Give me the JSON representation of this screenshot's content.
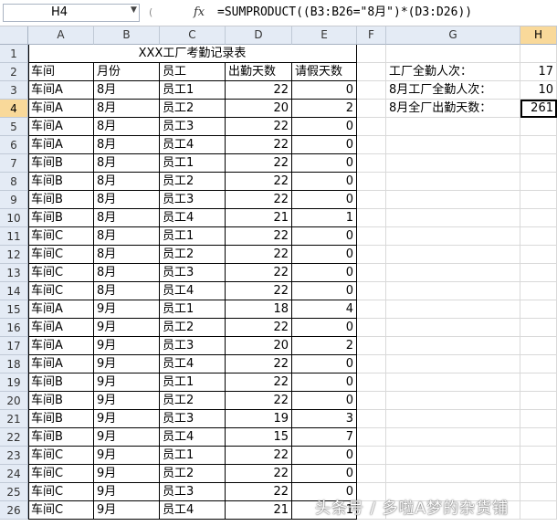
{
  "formula_bar": {
    "name_box": "H4",
    "fx_label": "fx",
    "formula": "=SUMPRODUCT((B3:B26=\"8月\")*(D3:D26))"
  },
  "columns": [
    "A",
    "B",
    "C",
    "D",
    "E",
    "F",
    "G",
    "H"
  ],
  "rows": [
    "1",
    "2",
    "3",
    "4",
    "5",
    "6",
    "7",
    "8",
    "9",
    "10",
    "11",
    "12",
    "13",
    "14",
    "15",
    "16",
    "17",
    "18",
    "19",
    "20",
    "21",
    "22",
    "23",
    "24",
    "25",
    "26"
  ],
  "sheet": {
    "title": "XXX工厂考勤记录表",
    "headers": [
      "车间",
      "月份",
      "员工",
      "出勤天数",
      "请假天数"
    ],
    "data": [
      [
        "车间A",
        "8月",
        "员工1",
        "22",
        "0"
      ],
      [
        "车间A",
        "8月",
        "员工2",
        "20",
        "2"
      ],
      [
        "车间A",
        "8月",
        "员工3",
        "22",
        "0"
      ],
      [
        "车间A",
        "8月",
        "员工4",
        "22",
        "0"
      ],
      [
        "车间B",
        "8月",
        "员工1",
        "22",
        "0"
      ],
      [
        "车间B",
        "8月",
        "员工2",
        "22",
        "0"
      ],
      [
        "车间B",
        "8月",
        "员工3",
        "22",
        "0"
      ],
      [
        "车间B",
        "8月",
        "员工4",
        "21",
        "1"
      ],
      [
        "车间C",
        "8月",
        "员工1",
        "22",
        "0"
      ],
      [
        "车间C",
        "8月",
        "员工2",
        "22",
        "0"
      ],
      [
        "车间C",
        "8月",
        "员工3",
        "22",
        "0"
      ],
      [
        "车间C",
        "8月",
        "员工4",
        "22",
        "0"
      ],
      [
        "车间A",
        "9月",
        "员工1",
        "18",
        "4"
      ],
      [
        "车间A",
        "9月",
        "员工2",
        "22",
        "0"
      ],
      [
        "车间A",
        "9月",
        "员工3",
        "20",
        "2"
      ],
      [
        "车间A",
        "9月",
        "员工4",
        "22",
        "0"
      ],
      [
        "车间B",
        "9月",
        "员工1",
        "22",
        "0"
      ],
      [
        "车间B",
        "9月",
        "员工2",
        "22",
        "0"
      ],
      [
        "车间B",
        "9月",
        "员工3",
        "19",
        "3"
      ],
      [
        "车间B",
        "9月",
        "员工4",
        "15",
        "7"
      ],
      [
        "车间C",
        "9月",
        "员工1",
        "22",
        "0"
      ],
      [
        "车间C",
        "9月",
        "员工2",
        "22",
        "0"
      ],
      [
        "车间C",
        "9月",
        "员工3",
        "22",
        "0"
      ],
      [
        "车间C",
        "9月",
        "员工4",
        "21",
        "1"
      ]
    ],
    "summary": [
      {
        "label": "工厂全勤人次：",
        "value": "17"
      },
      {
        "label": "8月工厂全勤人次：",
        "value": "10"
      },
      {
        "label": "8月全厂出勤天数：",
        "value": "261"
      }
    ]
  },
  "watermark": "头条号 / 多啦A梦的杂货铺",
  "selected_cell": "H4"
}
